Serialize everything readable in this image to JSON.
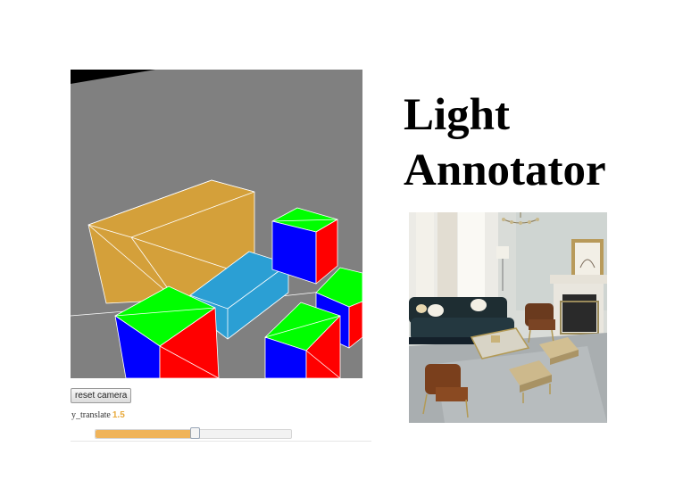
{
  "title": {
    "line1": "Light",
    "line2": "Annotator"
  },
  "viewer": {
    "reset_label": "reset camera",
    "slider_label": "y_translate",
    "slider_value": "1.5",
    "slider_fraction": 0.51,
    "colors": {
      "background": "#808080",
      "tall_box": "#d4a03a",
      "flat_box": "#2b9fd4",
      "cube_top": "#00ff00",
      "cube_left": "#0000ff",
      "cube_right": "#ff0000",
      "edge": "#ffffff"
    }
  },
  "colors": {
    "slider_fill": "#f0b45a",
    "slider_value": "#e8a93a"
  }
}
